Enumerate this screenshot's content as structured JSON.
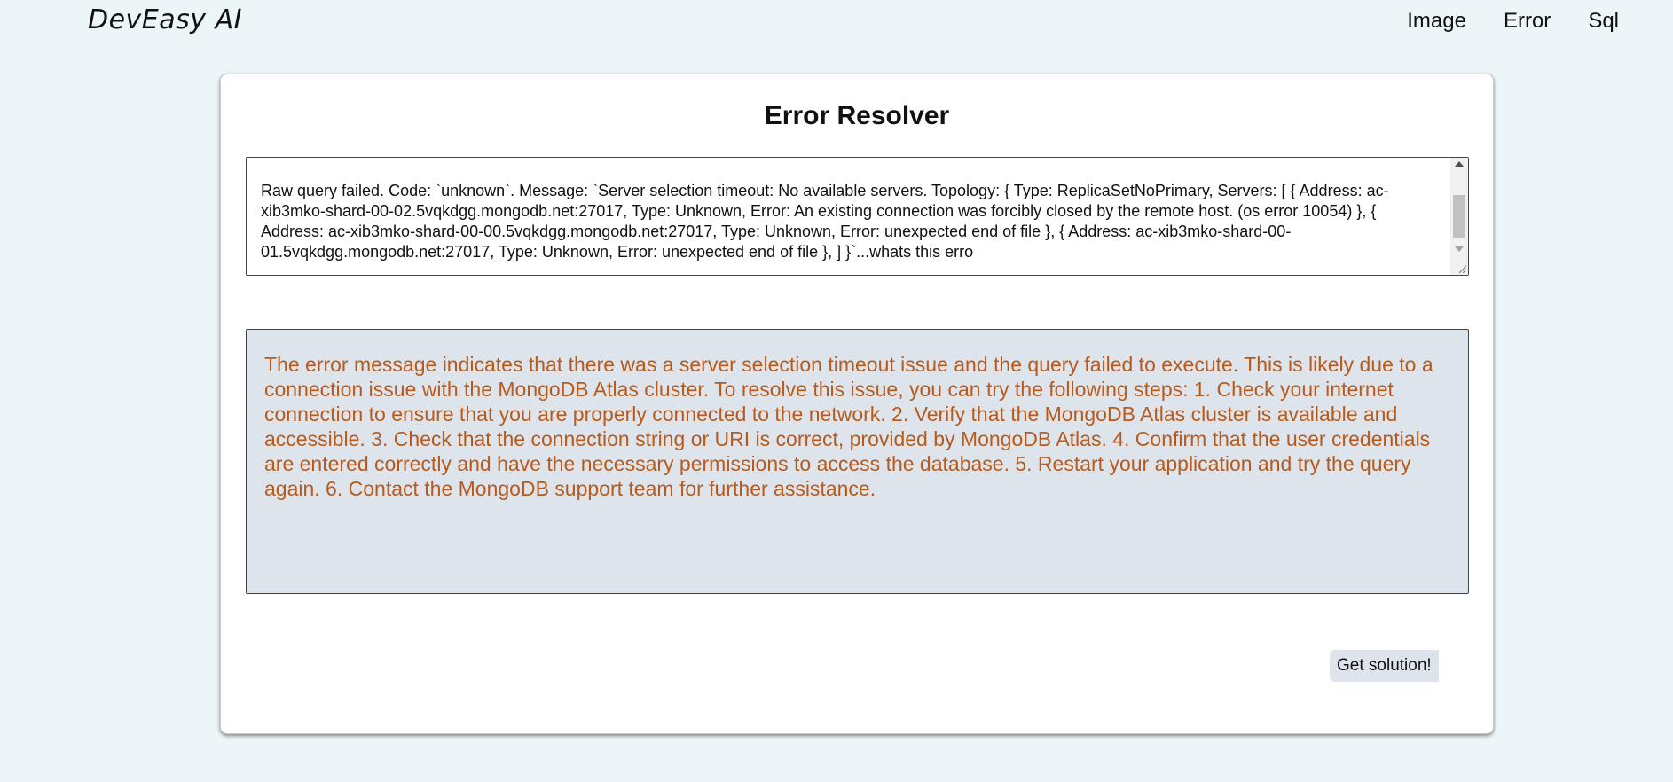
{
  "nav": {
    "brand": "DevEasy AI",
    "links": [
      "Image",
      "Error",
      "Sql"
    ]
  },
  "main": {
    "title": "Error Resolver",
    "error_input_value": "Raw query failed. Code: `unknown`. Message: `Server selection timeout: No available servers. Topology: { Type: ReplicaSetNoPrimary, Servers: [ { Address: ac-xib3mko-shard-00-02.5vqkdgg.mongodb.net:27017, Type: Unknown, Error: An existing connection was forcibly closed by the remote host. (os error 10054) }, { Address: ac-xib3mko-shard-00-00.5vqkdgg.mongodb.net:27017, Type: Unknown, Error: unexpected end of file }, { Address: ac-xib3mko-shard-00-01.5vqkdgg.mongodb.net:27017, Type: Unknown, Error: unexpected end of file }, ] }`...whats this erro",
    "solution_text": "The error message indicates that there was a server selection timeout issue and the query failed to execute. This is likely due to a connection issue with the MongoDB Atlas cluster. To resolve this issue, you can try the following steps: 1. Check your internet connection to ensure that you are properly connected to the network. 2. Verify that the MongoDB Atlas cluster is available and accessible. 3. Check that the connection string or URI is correct, provided by MongoDB Atlas. 4. Confirm that the user credentials are entered correctly and have the necessary permissions to access the database. 5. Restart your application and try the query again. 6. Contact the MongoDB support team for further assistance.",
    "submit_label": "Get solution!"
  },
  "colors": {
    "page_background": "#ecf6f8",
    "solution_background": "#dde4ec",
    "solution_text": "#b95a1a",
    "button_background": "#dde4ec"
  },
  "icons": [
    "scroll-up-arrow-icon",
    "scroll-down-arrow-icon",
    "resize-grip-icon"
  ]
}
